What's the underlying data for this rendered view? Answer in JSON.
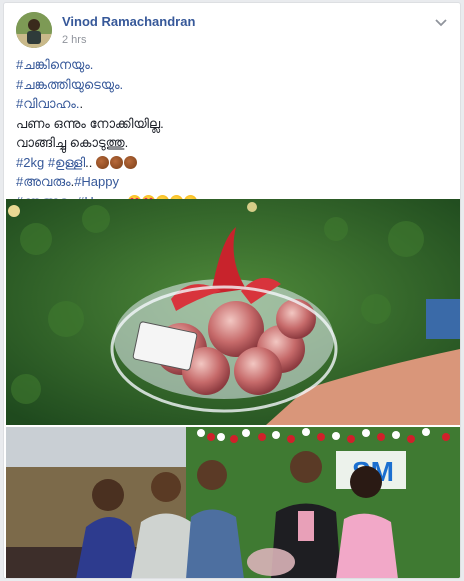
{
  "post": {
    "author": "Vinod Ramachandran",
    "timestamp": "2 hrs",
    "lines": [
      {
        "parts": [
          {
            "text": "#ചങ്കിനെയും.",
            "tag": true
          }
        ]
      },
      {
        "parts": [
          {
            "text": "#ചങ്കത്തിയുടെയും.",
            "tag": true
          }
        ]
      },
      {
        "parts": [
          {
            "text": "#വിവാഹം.",
            "tag": true
          },
          {
            "text": ".",
            "tag": false
          }
        ]
      },
      {
        "parts": [
          {
            "text": "പണം ഒന്നും നോക്കിയില്ല.",
            "tag": false
          }
        ]
      },
      {
        "parts": [
          {
            "text": "വാങ്ങിച്ചു കൊടുത്തു.",
            "tag": false
          }
        ]
      },
      {
        "parts": [
          {
            "text": "#2kg",
            "tag": true
          },
          {
            "text": " ",
            "tag": false
          },
          {
            "text": "#ഉള്ളി",
            "tag": true
          },
          {
            "text": ".. ",
            "tag": false
          }
        ],
        "emojis": [
          "onion-emoji",
          "onion-emoji",
          "onion-emoji"
        ]
      },
      {
        "parts": [
          {
            "text": "#അവരും",
            "tag": true
          },
          {
            "text": ".",
            "tag": false
          },
          {
            "text": "#Happy",
            "tag": true
          }
        ]
      },
      {
        "parts": [
          {
            "text": "#ഞങ്ങളും",
            "tag": true
          },
          {
            "text": " ",
            "tag": false
          },
          {
            "text": "#Happy",
            "tag": true
          },
          {
            "text": ". ",
            "tag": false
          }
        ],
        "emojis": [
          "hearteyes-emoji",
          "hearteyes-emoji",
          "kiss-emoji",
          "kiss-emoji",
          "kiss-emoji"
        ]
      }
    ]
  },
  "photos": [
    {
      "name": "photo-onion-basket",
      "stage_banner_text": ""
    },
    {
      "name": "photo-group-gift",
      "stage_banner_text": "SM"
    }
  ],
  "colors": {
    "link": "#365899",
    "text": "#1d2129",
    "meta": "#90949c",
    "background": "#e9ebee"
  },
  "icons": [
    "chevron-down-icon",
    "onion-emoji",
    "heart-eyes-emoji",
    "kissing-face-emoji"
  ]
}
